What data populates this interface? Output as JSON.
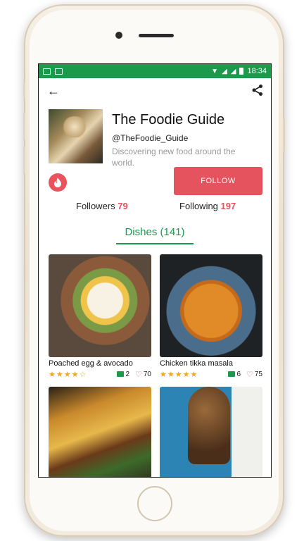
{
  "status_bar": {
    "time": "18:34"
  },
  "profile": {
    "name": "The Foodie Guide",
    "handle": "@TheFoodie_Guide",
    "bio": "Discovering new food around the world."
  },
  "actions": {
    "follow_label": "FOLLOW"
  },
  "counts": {
    "followers_label": "Followers",
    "followers_value": "79",
    "following_label": "Following",
    "following_value": "197"
  },
  "tab": {
    "label": "Dishes (141)"
  },
  "dishes": [
    {
      "name": "Poached egg & avocado",
      "stars": "★★★★☆",
      "rating": 4,
      "comments": "2",
      "likes": "70"
    },
    {
      "name": "Chicken tikka masala",
      "stars": "★★★★★",
      "rating": 5,
      "comments": "6",
      "likes": "75"
    },
    {
      "name": "",
      "stars": "",
      "comments": "",
      "likes": ""
    },
    {
      "name": "",
      "stars": "",
      "comments": "",
      "likes": ""
    }
  ],
  "colors": {
    "brand_green": "#1b9a4c",
    "accent_red": "#e5535f",
    "star": "#f2a51c"
  },
  "icons": [
    "back-arrow-icon",
    "share-icon",
    "flame-icon",
    "comment-icon",
    "heart-icon",
    "star-icon"
  ]
}
